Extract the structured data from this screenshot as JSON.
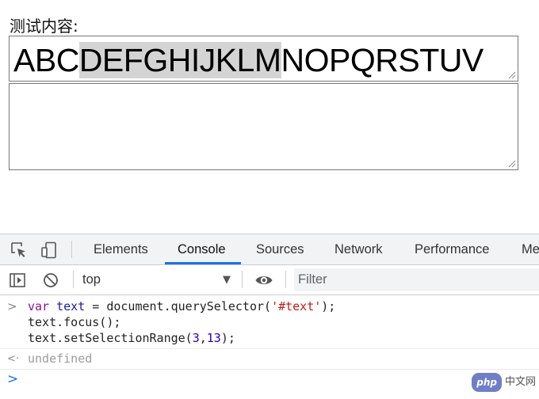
{
  "page": {
    "label": "测试内容:",
    "textarea1": {
      "before": "ABC",
      "selected": "DEFGHIJKLM",
      "after": "NOPQRSTUV"
    },
    "textarea2": {
      "value": ""
    }
  },
  "devtools": {
    "tabs": [
      "Elements",
      "Console",
      "Sources",
      "Network",
      "Performance",
      "Me"
    ],
    "active_tab": "Console",
    "context": "top",
    "context_arrow": "▼",
    "filter_placeholder": "Filter",
    "accent_color": "#1a73e8",
    "console": {
      "input_marker": ">",
      "output_marker": "<·",
      "line1": {
        "kw": "var",
        "var": "text",
        "mid": " = document.querySelector(",
        "str": "'#text'",
        "end": ");"
      },
      "line2": "text.focus();",
      "line3": {
        "pre": "text.setSelectionRange(",
        "n1": "3",
        "comma": ",",
        "n2": "13",
        "end": ");"
      },
      "result": "undefined",
      "prompt": ">"
    }
  },
  "watermark": {
    "badge": "php",
    "text": "中文网"
  }
}
